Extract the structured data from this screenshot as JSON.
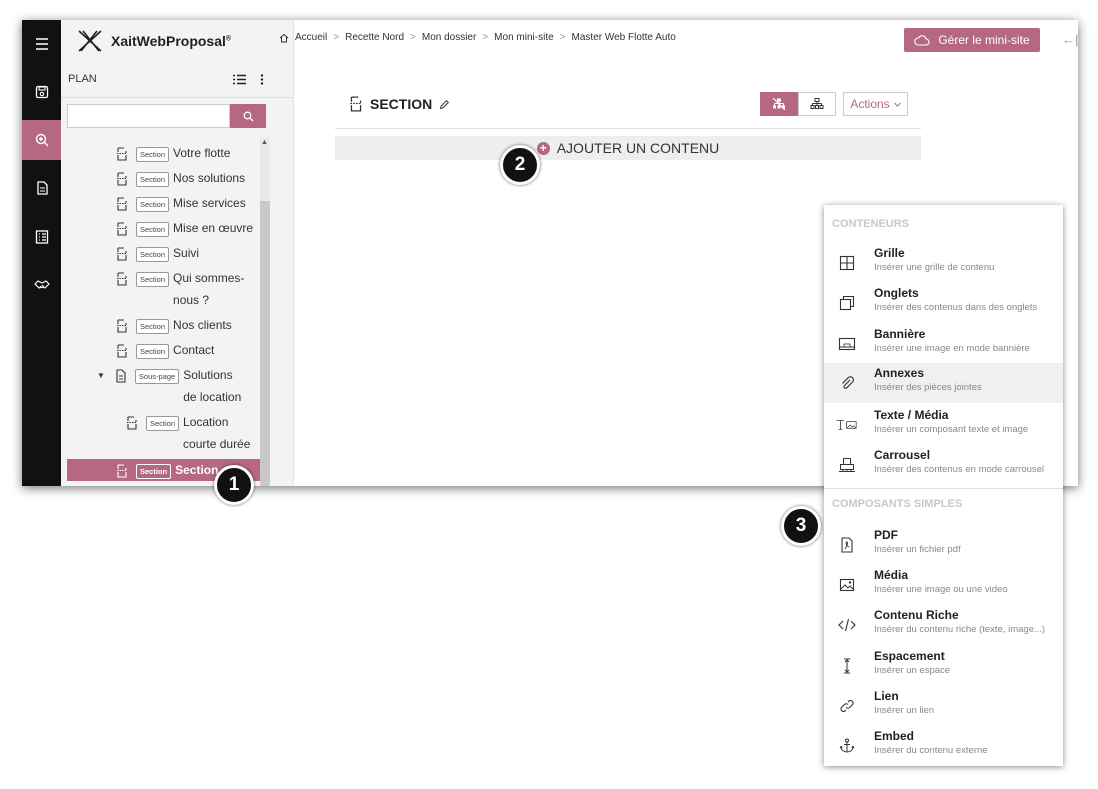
{
  "app": {
    "name": "XaitWebProposal",
    "trademark": "®"
  },
  "rail": {
    "items": [
      {
        "icon": "hamburger-icon"
      },
      {
        "icon": "save-icon"
      },
      {
        "icon": "zoom-icon",
        "active": true
      },
      {
        "icon": "document-icon"
      },
      {
        "icon": "checklist-icon"
      },
      {
        "icon": "handshake-icon"
      }
    ]
  },
  "plan": {
    "title": "PLAN",
    "search_placeholder": "",
    "tree": [
      {
        "badge": "Section",
        "label": "Votre flotte"
      },
      {
        "badge": "Section",
        "label": "Nos solutions"
      },
      {
        "badge": "Section",
        "label": "Mise services"
      },
      {
        "badge": "Section",
        "label": "Mise en œuvre"
      },
      {
        "badge": "Section",
        "label": "Suivi"
      },
      {
        "badge": "Section",
        "label_line1": "Qui sommes-",
        "label_line2": "nous ?"
      },
      {
        "badge": "Section",
        "label": "Nos clients"
      },
      {
        "badge": "Section",
        "label": "Contact"
      },
      {
        "badge": "Sous-page",
        "label_line1": "Solutions",
        "label_line2": "de location"
      },
      {
        "badge": "Section",
        "label_line1": "Location",
        "label_line2": "courte durée"
      },
      {
        "badge": "Section",
        "label": "Section",
        "selected": true
      }
    ]
  },
  "breadcrumb": [
    "Accueil",
    "Recette Nord",
    "Mon dossier",
    "Mon mini-site",
    "Master Web Flotte Auto"
  ],
  "breadcrumb_sep": ">",
  "header": {
    "manage_label": "Gérer le mini-site",
    "collapse_label": "←|"
  },
  "section": {
    "title": "SECTION",
    "actions_label": "Actions",
    "add_content_label": "AJOUTER UN CONTENU"
  },
  "callouts": [
    "1",
    "2",
    "3"
  ],
  "menu": {
    "categories": [
      {
        "title": "CONTENEURS",
        "items": [
          {
            "title": "Grille",
            "desc": "Insérer une grille de contenu",
            "icon": "grid-icon"
          },
          {
            "title": "Onglets",
            "desc": "Insérer des contenus dans des onglets",
            "icon": "tabs-icon"
          },
          {
            "title": "Bannière",
            "desc": "Insérer une image en mode bannière",
            "icon": "banner-icon"
          },
          {
            "title": "Annexes",
            "desc": "Insérer des pièces jointes",
            "icon": "paperclip-icon",
            "hover": true
          },
          {
            "title": "Texte / Média",
            "desc": "Insérer un composant texte et image",
            "icon": "text-media-icon"
          },
          {
            "title": "Carrousel",
            "desc": "Insérer des contenus en mode carrousel",
            "icon": "carousel-icon"
          }
        ]
      },
      {
        "title": "COMPOSANTS SIMPLES",
        "items": [
          {
            "title": "PDF",
            "desc": "Insérer un fichier pdf",
            "icon": "pdf-icon"
          },
          {
            "title": "Média",
            "desc": "Insérer une image ou une video",
            "icon": "image-icon"
          },
          {
            "title": "Contenu Riche",
            "desc": "Insérer du contenu riche (texte, image...)",
            "icon": "code-icon"
          },
          {
            "title": "Espacement",
            "desc": "Insérer un espace",
            "icon": "spacing-icon"
          },
          {
            "title": "Lien",
            "desc": "Insérer un lien",
            "icon": "link-icon"
          },
          {
            "title": "Embed",
            "desc": "Insérer du contenu externe",
            "icon": "anchor-icon"
          }
        ]
      }
    ]
  },
  "colors": {
    "accent": "#b5687f",
    "rail": "#111111",
    "panel": "#f3f3f3"
  }
}
